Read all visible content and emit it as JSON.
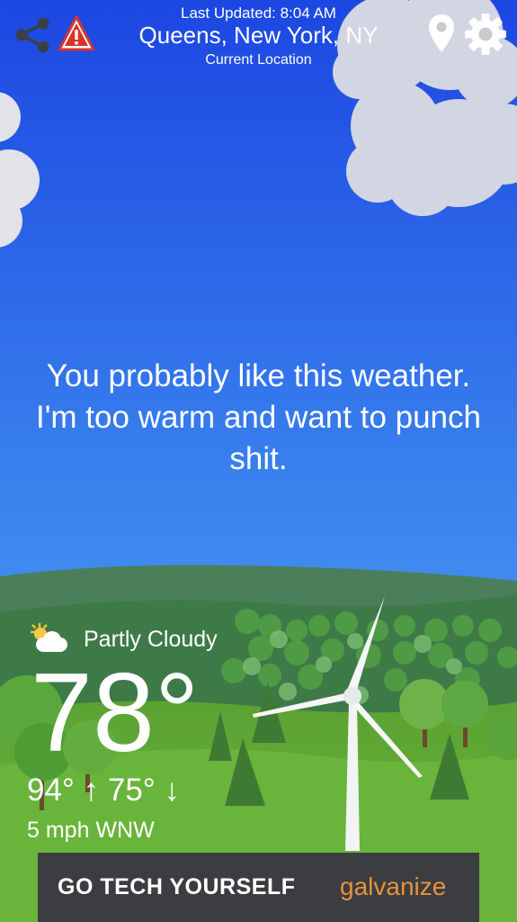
{
  "header": {
    "last_updated": "Last Updated: 8:04 AM",
    "location": "Queens, New York, NY",
    "sublocation": "Current Location"
  },
  "icons": {
    "share": "share-icon",
    "alert": "alert-warning-icon",
    "location": "location-pin-icon",
    "settings": "gear-icon"
  },
  "message": "You probably like this weather. I'm too warm and want to punch shit.",
  "weather": {
    "condition": "Partly Cloudy",
    "condition_icon": "partly-cloudy-icon",
    "temperature": "78°",
    "high_low": "94° ↑  75° ↓",
    "wind": "5 mph WNW"
  },
  "ad": {
    "text": "GO TECH YOURSELF",
    "brand": "galvanize"
  },
  "colors": {
    "sky_top": "#1f4fe6",
    "sky_bottom": "#56a6f5",
    "hills": "#4a8a46",
    "grass": "#66b035",
    "ad_background": "#3b3d40",
    "ad_brand": "#e8923a",
    "alert_red": "#d8342c"
  }
}
